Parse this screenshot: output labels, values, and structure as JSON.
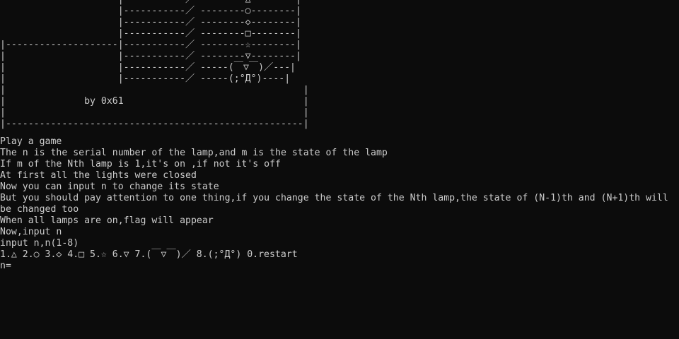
{
  "banner": {
    "lines": [
      "                     |-----------／ --------△--------|",
      "                     |-----------／ --------○--------|",
      "                     |-----------／ --------◇--------|",
      "                     |-----------／ --------□--------|",
      "|--------------------|-----------／ --------☆--------|",
      "|                    |-----------／ --------▽--------|",
      "|                    |-----------／ -----(￣▽￣)／---|",
      "|                    |-----------／ -----(;°Д°)----|",
      "|                                                     |",
      "|              by 0x61                                |",
      "|                                                     |",
      "|-----------------------------------------------------|"
    ]
  },
  "log": {
    "lines": [
      "Play a game",
      "The n is the serial number of the lamp,and m is the state of the lamp",
      "If m of the Nth lamp is 1,it's on ,if not it's off",
      "At first all the lights were closed",
      "Now you can input n to change its state",
      "But you should pay attention to one thing,if you change the state of the Nth lamp,the state of (N-1)th and (N+1)th will be changed too",
      "When all lamps are on,flag will appear",
      "Now,input n",
      "input n,n(1-8)",
      "1.△ 2.○ 3.◇ 4.□ 5.☆ 6.▽ 7.(￣▽￣)／ 8.(;°Д°) 0.restart"
    ],
    "prompt": "n="
  },
  "colors": {
    "background": "#0c0c0c",
    "text": "#cccccc"
  }
}
